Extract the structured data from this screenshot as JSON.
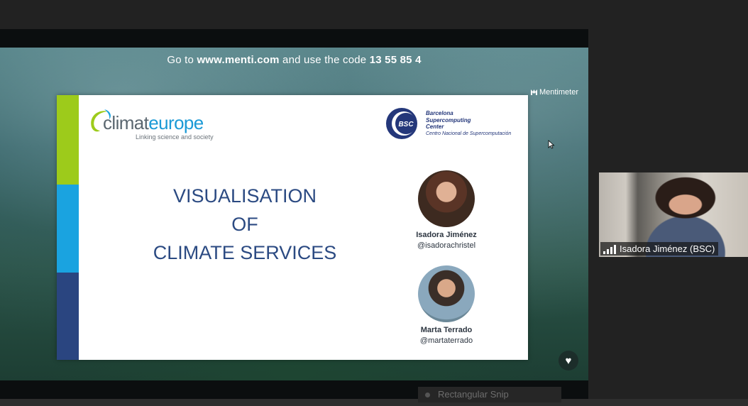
{
  "presentation": {
    "banner": {
      "prefix": "Go to",
      "url": "www.menti.com",
      "middle": "and use the code",
      "code": "13 55 85 4"
    },
    "brand": "Mentimeter",
    "slide": {
      "logo_left": {
        "word_part1": "climat",
        "word_part2": "europe",
        "tagline": "Linking science and society"
      },
      "logo_right": {
        "abbr": "BSC",
        "name_lines": [
          "Barcelona",
          "Supercomputing",
          "Center"
        ],
        "subtitle": "Centro Nacional de Supercomputación"
      },
      "title_lines": [
        "VISUALISATION",
        "OF",
        "CLIMATE SERVICES"
      ],
      "speakers": [
        {
          "name": "Isadora Jiménez",
          "handle": "@isadorachristel"
        },
        {
          "name": "Marta Terrado",
          "handle": "@martaterrado"
        }
      ],
      "colors": {
        "green": "#9dcb1b",
        "blue": "#1aa3e0",
        "navy": "#2a4580",
        "title": "#2b4a82"
      }
    },
    "reaction_icon": "heart-icon"
  },
  "participant": {
    "name": "Isadora Jiménez (BSC)",
    "signal_icon": "signal-bars-icon"
  },
  "hidden_label": "Rectangular Snip"
}
